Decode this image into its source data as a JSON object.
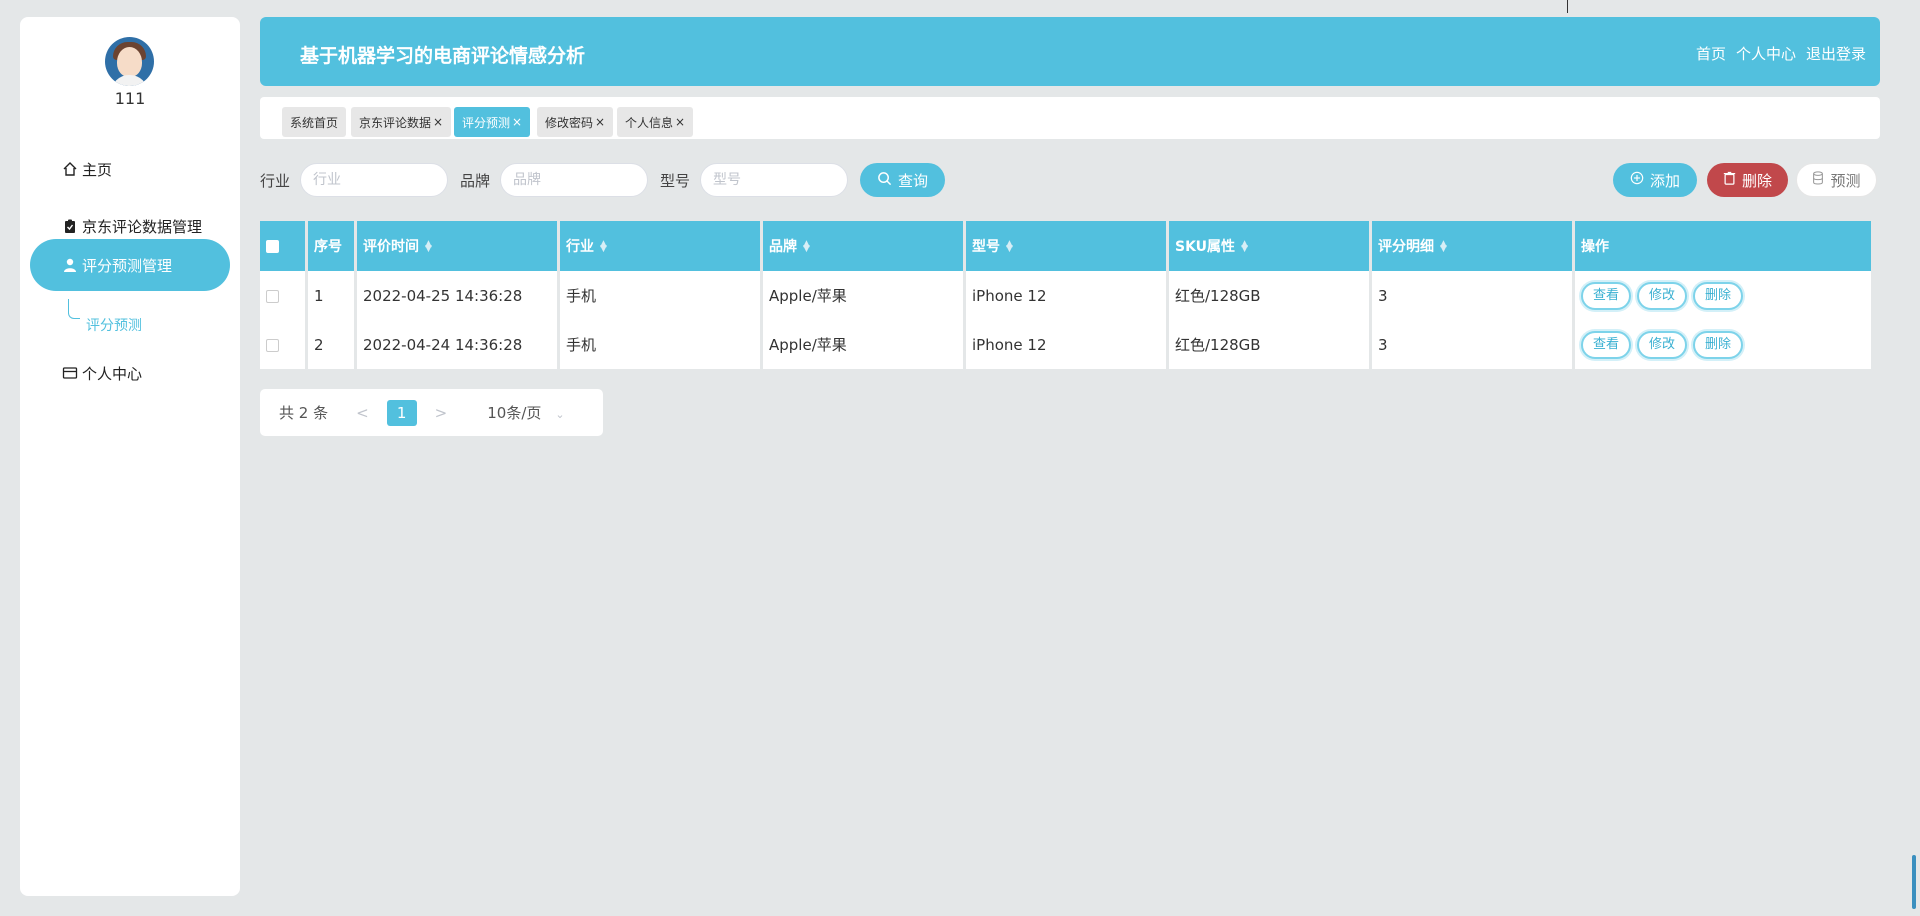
{
  "user": {
    "name": "111"
  },
  "sidebar": {
    "items": [
      {
        "label": "主页"
      },
      {
        "label": "京东评论数据管理"
      },
      {
        "label": "评分预测管理"
      },
      {
        "label": "个人中心"
      }
    ],
    "sub_item": "评分预测"
  },
  "header": {
    "title": "基于机器学习的电商评论情感分析",
    "links": [
      "首页",
      "个人中心",
      "退出登录"
    ]
  },
  "tabs": [
    {
      "label": "系统首页"
    },
    {
      "label": "京东评论数据"
    },
    {
      "label": "评分预测"
    },
    {
      "label": "修改密码"
    },
    {
      "label": "个人信息"
    }
  ],
  "filters": [
    {
      "label": "行业",
      "placeholder": "行业"
    },
    {
      "label": "品牌",
      "placeholder": "品牌"
    },
    {
      "label": "型号",
      "placeholder": "型号"
    }
  ],
  "buttons": {
    "query": "查询",
    "add": "添加",
    "delete": "删除",
    "predict": "预测"
  },
  "table": {
    "columns": [
      "序号",
      "评价时间",
      "行业",
      "品牌",
      "型号",
      "SKU属性",
      "评分明细",
      "操作"
    ],
    "rows": [
      {
        "index": "1",
        "time": "2022-04-25 14:36:28",
        "industry": "手机",
        "brand": "Apple/苹果",
        "model": "iPhone 12",
        "sku": "红色/128GB",
        "score": "3"
      },
      {
        "index": "2",
        "time": "2022-04-24 14:36:28",
        "industry": "手机",
        "brand": "Apple/苹果",
        "model": "iPhone 12",
        "sku": "红色/128GB",
        "score": "3"
      }
    ],
    "actions": [
      "查看",
      "修改",
      "删除"
    ]
  },
  "pagination": {
    "total": "共 2 条",
    "current_page": "1",
    "page_size": "10条/页",
    "prev": "<",
    "next": ">"
  },
  "colors": {
    "accent": "#52c0de",
    "danger": "#c1484b",
    "background": "#e4e7e8"
  }
}
